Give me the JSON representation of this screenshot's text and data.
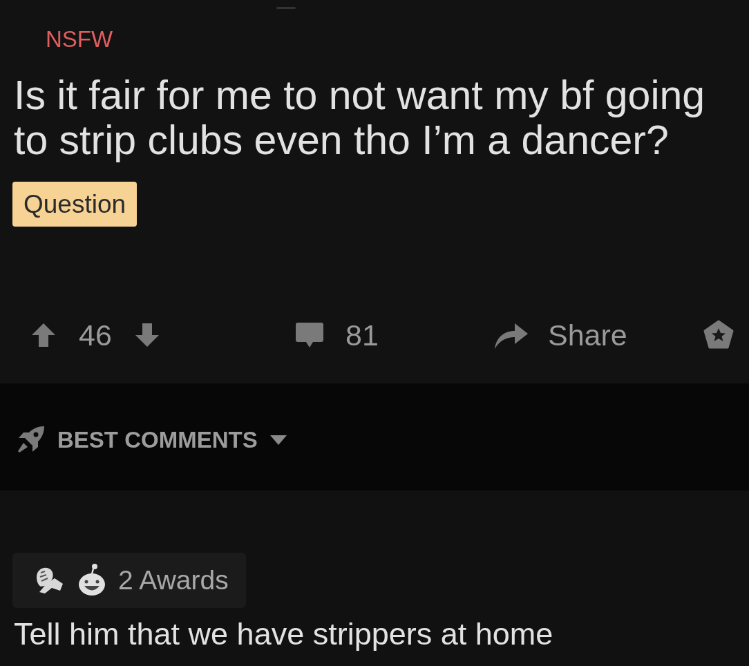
{
  "post": {
    "nsfw_label": "NSFW",
    "title": "Is it fair for me to not want my bf going to strip clubs even tho I’m a dancer?",
    "flair": "Question"
  },
  "actions": {
    "votes": "46",
    "comments": "81",
    "share": "Share"
  },
  "sort": {
    "label": "BEST COMMENTS"
  },
  "comment": {
    "awards": "2 Awards",
    "body": "Tell him that we have strippers at home"
  }
}
